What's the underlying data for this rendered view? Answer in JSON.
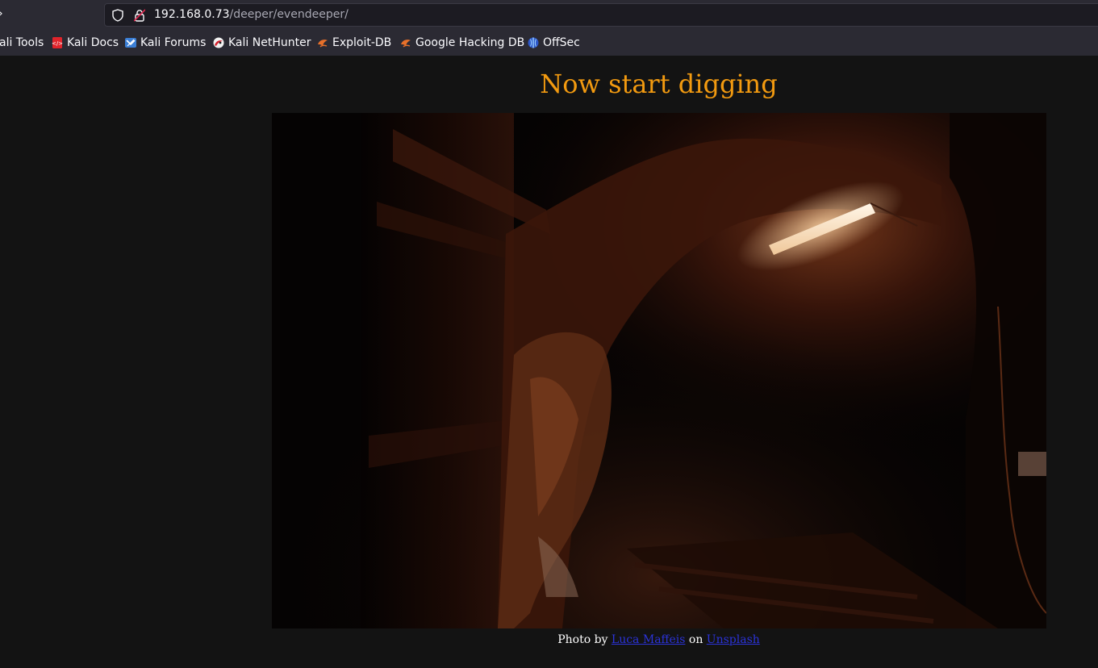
{
  "browser": {
    "url_host": "192.168.0.73",
    "url_path": "/deeper/evendeeper/",
    "bookmarks": [
      {
        "label": "ali Tools",
        "icon": "kali-tools-icon"
      },
      {
        "label": "Kali Docs",
        "icon": "kali-docs-icon"
      },
      {
        "label": "Kali Forums",
        "icon": "kali-forums-icon"
      },
      {
        "label": "Kali NetHunter",
        "icon": "kali-nethunter-icon"
      },
      {
        "label": "Exploit-DB",
        "icon": "exploit-db-icon"
      },
      {
        "label": "Google Hacking DB",
        "icon": "google-hacking-db-icon"
      },
      {
        "label": "OffSec",
        "icon": "offsec-icon"
      }
    ]
  },
  "page": {
    "title": "Now start digging",
    "caption": {
      "prefix": "Photo by",
      "author": "Luca Maffeis",
      "middle": "on",
      "source": "Unsplash"
    }
  },
  "colors": {
    "title": "#f29a10",
    "link": "#2b33d9",
    "page_background": "#131313",
    "chrome_background": "#2b2a33"
  }
}
